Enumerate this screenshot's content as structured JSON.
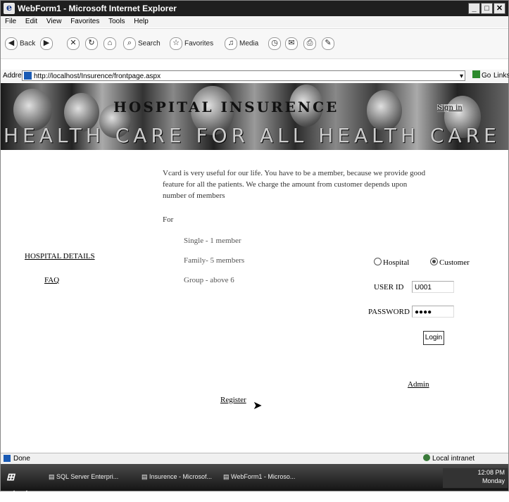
{
  "window": {
    "title": "WebForm1 - Microsoft Internet Explorer"
  },
  "menu": [
    "File",
    "Edit",
    "View",
    "Favorites",
    "Tools",
    "Help"
  ],
  "toolbar": {
    "back": "Back",
    "search": "Search",
    "favorites": "Favorites",
    "media": "Media"
  },
  "address": {
    "label": "Address",
    "url": "http://localhost/Insurence/frontpage.aspx",
    "go": "Go",
    "links": "Links"
  },
  "banner": {
    "title": "HOSPITAL INSURENCE",
    "signin": "Sign in",
    "tagline": "HEALTH CARE FOR ALL HEALTH CARE FOR ALL HEALTH CARE FOR ALL"
  },
  "intro": "Vcard is very useful for our life. You have to be a member, because we provide good feature for all the patients. We charge the amount from customer depends upon number of members",
  "for_label": "For",
  "plans": [
    "Single - 1 member",
    "Family- 5 members",
    "Group - above 6"
  ],
  "nav": {
    "hospital_details": "HOSPITAL DETAILS",
    "faq": "FAQ",
    "admin": "Admin",
    "register": "Register"
  },
  "login": {
    "radio_hospital": "Hospital",
    "radio_customer": "Customer",
    "userid_label": "USER ID",
    "userid_value": "U001",
    "password_label": "PASSWORD",
    "password_value": "●●●●",
    "button": "Login"
  },
  "status": {
    "left": "Done",
    "zone": "Local intranet"
  },
  "taskbar": {
    "start": "start",
    "tasks": [
      "SQL Server Enterpri...",
      "Insurence - Microsof...",
      "WebForm1 - Microso..."
    ],
    "time": "12:08 PM",
    "day": "Monday"
  }
}
